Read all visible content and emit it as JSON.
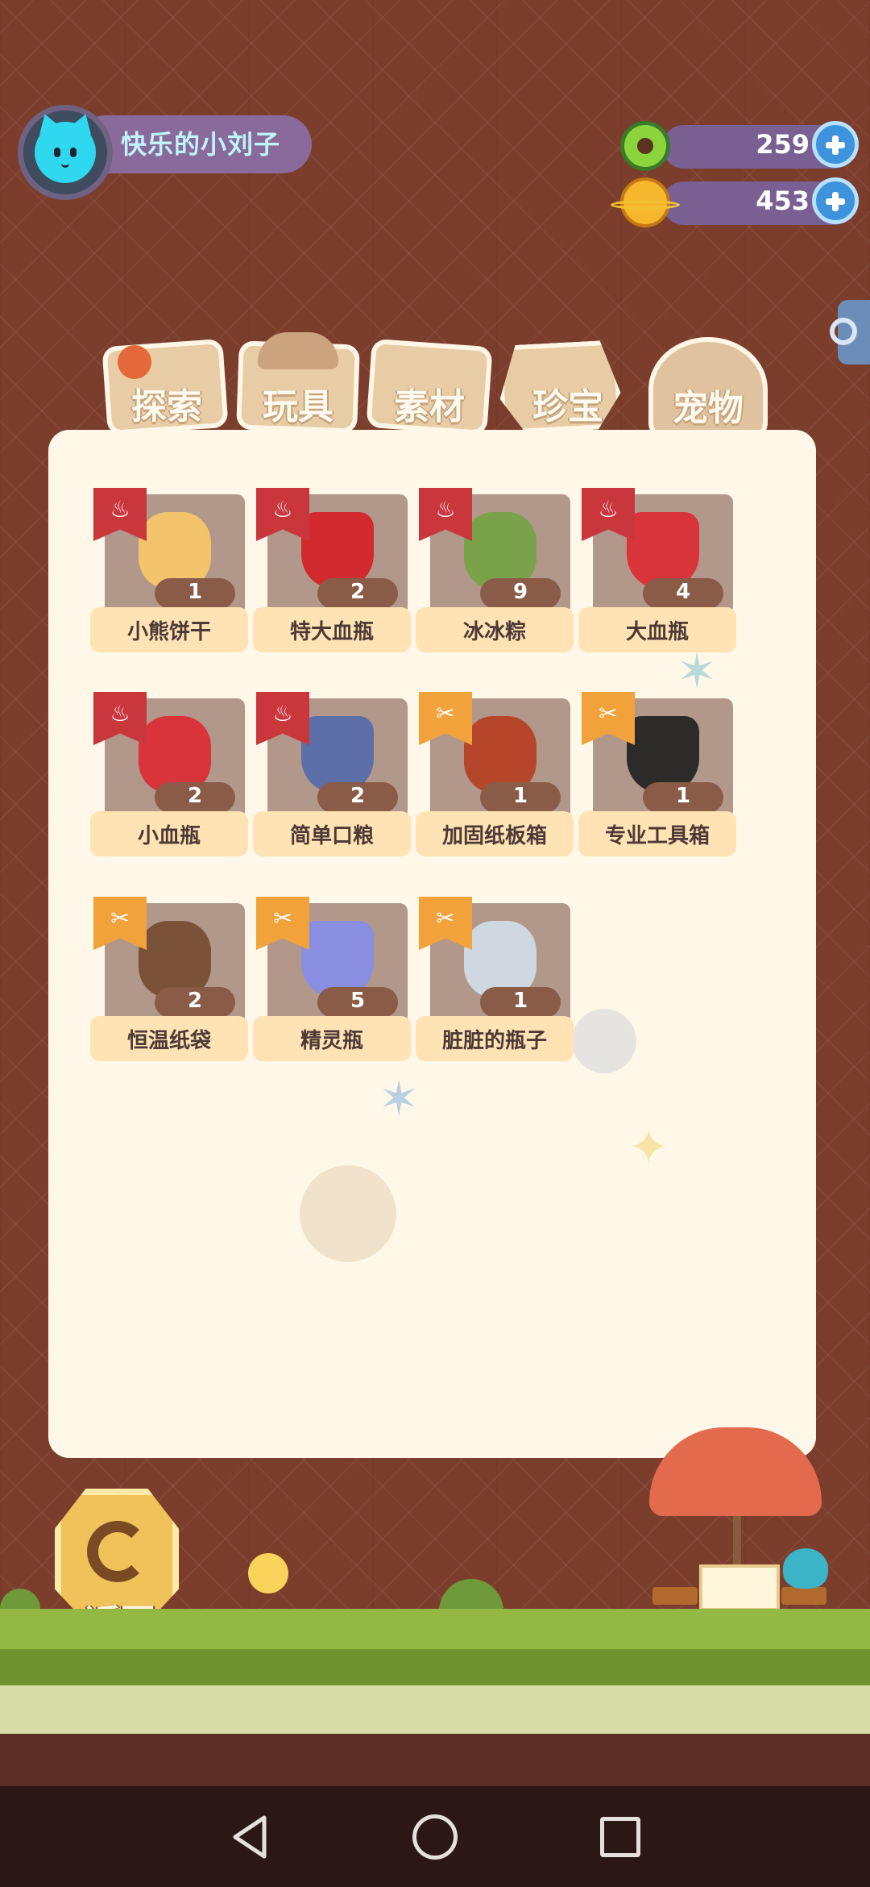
{
  "profile": {
    "name": "快乐的小刘子",
    "avatar_icon": "cat-avatar-icon"
  },
  "currencies": [
    {
      "name": "donut-coin",
      "value": "259",
      "icon": "donut-coin-icon"
    },
    {
      "name": "planet-coin",
      "value": "453",
      "icon": "planet-coin-icon"
    }
  ],
  "tabs": [
    {
      "label": "探索",
      "active": false
    },
    {
      "label": "玩具",
      "active": false
    },
    {
      "label": "素材",
      "active": false
    },
    {
      "label": "珍宝",
      "active": false
    },
    {
      "label": "宠物",
      "active": true
    }
  ],
  "items": [
    {
      "name": "小熊饼干",
      "count": "1",
      "badge": "food-bowl-icon"
    },
    {
      "name": "特大血瓶",
      "count": "2",
      "badge": "food-bowl-icon"
    },
    {
      "name": "冰冰粽",
      "count": "9",
      "badge": "food-bowl-icon"
    },
    {
      "name": "大血瓶",
      "count": "4",
      "badge": "food-bowl-icon"
    },
    {
      "name": "小血瓶",
      "count": "2",
      "badge": "food-bowl-icon"
    },
    {
      "name": "简单口粮",
      "count": "2",
      "badge": "food-bowl-icon"
    },
    {
      "name": "加固纸板箱",
      "count": "1",
      "badge": "net-icon"
    },
    {
      "name": "专业工具箱",
      "count": "1",
      "badge": "net-icon"
    },
    {
      "name": "恒温纸袋",
      "count": "2",
      "badge": "net-icon"
    },
    {
      "name": "精灵瓶",
      "count": "5",
      "badge": "net-icon"
    },
    {
      "name": "脏脏的瓶子",
      "count": "1",
      "badge": "net-icon"
    }
  ],
  "back": {
    "label": "返回"
  },
  "colors": {
    "background": "#7b3d2c",
    "panel": "#fff7e8",
    "food_badge": "#c9373d",
    "net_badge": "#f2a23b",
    "accent_blue": "#3f92dc"
  }
}
